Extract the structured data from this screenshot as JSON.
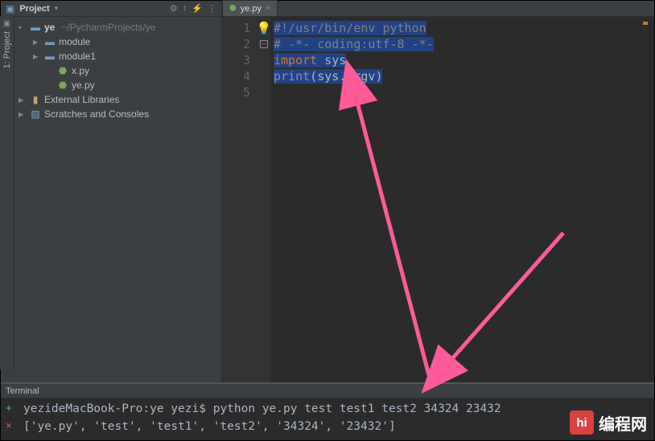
{
  "vertStrip": {
    "label": "1: Project"
  },
  "sidebar": {
    "title": "Project",
    "icons": [
      "⚙",
      "↕",
      "⚡",
      "⋮"
    ]
  },
  "tree": {
    "root": {
      "name": "ye",
      "path": "~/PycharmProjects/ye"
    },
    "items": [
      {
        "indent": 22,
        "arrow": "▶",
        "icon": "folder",
        "label": "module"
      },
      {
        "indent": 22,
        "arrow": "▶",
        "icon": "folder",
        "label": "module1"
      },
      {
        "indent": 38,
        "arrow": "",
        "icon": "py",
        "label": "x.py"
      },
      {
        "indent": 38,
        "arrow": "",
        "icon": "py",
        "label": "ye.py"
      }
    ],
    "externalLibs": "External Libraries",
    "scratches": "Scratches and Consoles"
  },
  "tabs": {
    "active": "ye.py"
  },
  "code": {
    "line1": {
      "shebang": "#!/usr/bin/env python"
    },
    "line2": {
      "comment": "# -*- coding:utf-8 -*-"
    },
    "line3": {
      "kw": "import",
      "mod": " sys"
    },
    "line4": {
      "fn": "print",
      "open": "(",
      "obj": "sys",
      "dot": ".",
      "attr": "argv",
      "close": ")"
    },
    "gutter": [
      "1",
      "2",
      "3",
      "4",
      "5"
    ]
  },
  "terminal": {
    "title": "Terminal",
    "line1": {
      "host": "yezideMacBook-Pro:ye yezi$",
      "cmd": " python ye.py test test1 test2 34324 23432"
    },
    "line2": "['ye.py', 'test', 'test1', 'test2', '34324', '23432']"
  },
  "watermark": {
    "logo": "hi",
    "text": "编程网"
  }
}
